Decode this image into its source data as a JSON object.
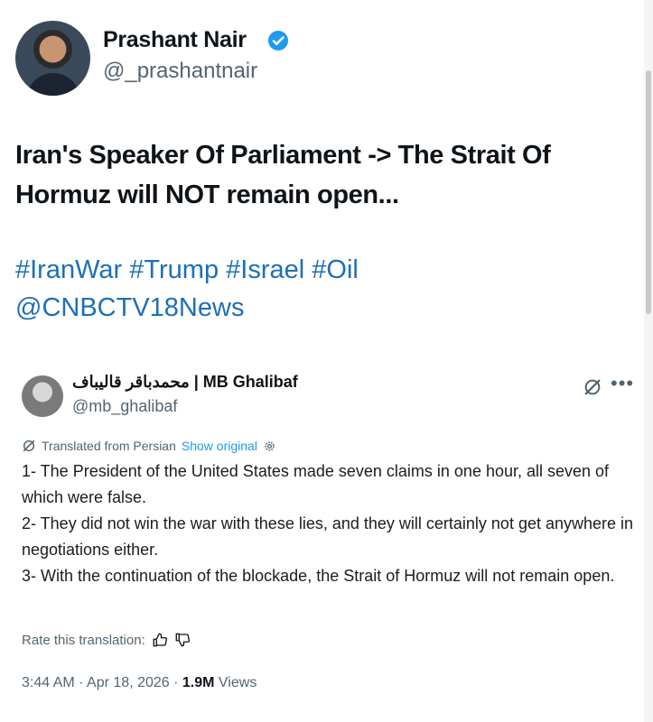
{
  "author": {
    "name": "Prashant Nair",
    "handle": "@_prashantnair"
  },
  "tweet": {
    "line1": "Iran's Speaker Of Parliament -> The Strait Of",
    "line2": "Hormuz will NOT remain open...",
    "hashtags": [
      "#IranWar",
      "#Trump",
      "#Israel",
      "#Oil"
    ],
    "mention": "@CNBCTV18News"
  },
  "quoted": {
    "name": "محمدباقر قالیباف | MB Ghalibaf",
    "handle": "@mb_ghalibaf",
    "translated_label": "Translated from Persian",
    "show_original": "Show original",
    "body": [
      "1- The President of the United States made seven claims in one hour, all seven of which were false.",
      "2- They did not win the war with these lies, and they will certainly not get anywhere in negotiations either.",
      "3- With the continuation of the blockade, the Strait of Hormuz will not remain open."
    ],
    "rate_label": "Rate this translation:",
    "time": "3:44 AM",
    "date": "Apr 18, 2026",
    "views_count": "1.9M",
    "views_label": "Views"
  },
  "icons": {
    "verified": "verified-badge-icon",
    "grok": "grok-icon",
    "more": "more-icon",
    "thumbs_up": "thumbs-up-icon",
    "thumbs_down": "thumbs-down-icon",
    "settings": "gear-icon"
  },
  "colors": {
    "link": "#1d6fb8",
    "verified": "#1d9bf0",
    "secondary_text": "#536471"
  }
}
